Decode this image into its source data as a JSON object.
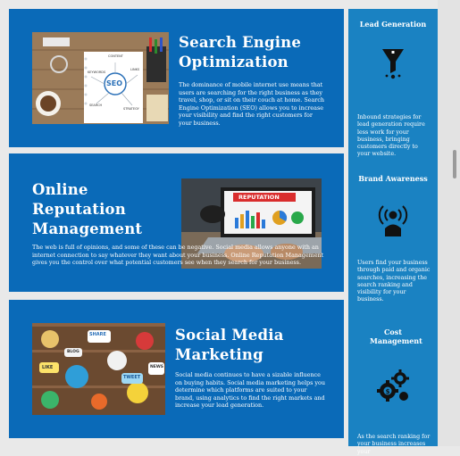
{
  "services": [
    {
      "title": "Search Engine Optimization",
      "body": "The dominance of mobile internet use means that users are searching for the right business as they travel, shop, or sit on their couch at home. Search Engine Optimization (SEO) allows you to increase your visibility and find the right customers for your business.",
      "image_label": "SEO",
      "image_words": [
        "CONTENT",
        "KEYWORDS",
        "LINKS",
        "SEARCH",
        "STRATEGY"
      ]
    },
    {
      "title": "Online Reputation Management",
      "body": "The web is full of opinions, and some of these can be negative. Social media allows anyone with an internet connection to say whatever they want about your business. Online Reputation Management gives you the control over what potential customers see when they search for your business.",
      "image_label": "REPUTATION"
    },
    {
      "title": "Social Media Marketing",
      "body": "Social media continues to have a sizable influence on buying habits. Social media marketing helps you determine which platforms are suited to your brand, using analytics to find the right markets and increase your lead generation.",
      "image_words": [
        "SHARE",
        "LIKE",
        "TWEET",
        "BLOG",
        "NEWS"
      ]
    }
  ],
  "sidebar": [
    {
      "title": "Lead Generation",
      "text": "Inbound strategies for lead generation require less work for your business, bringing customers directly to your website.",
      "icon": "funnel-icon"
    },
    {
      "title": "Brand Awareness",
      "text": "Users find your business through paid and organic searches, increasing the search ranking and visibility for your business.",
      "icon": "broadcast-person-icon"
    },
    {
      "title": "Cost Management",
      "text": "As the search ranking for your business increases your",
      "icon": "gears-dollar-icon"
    }
  ]
}
